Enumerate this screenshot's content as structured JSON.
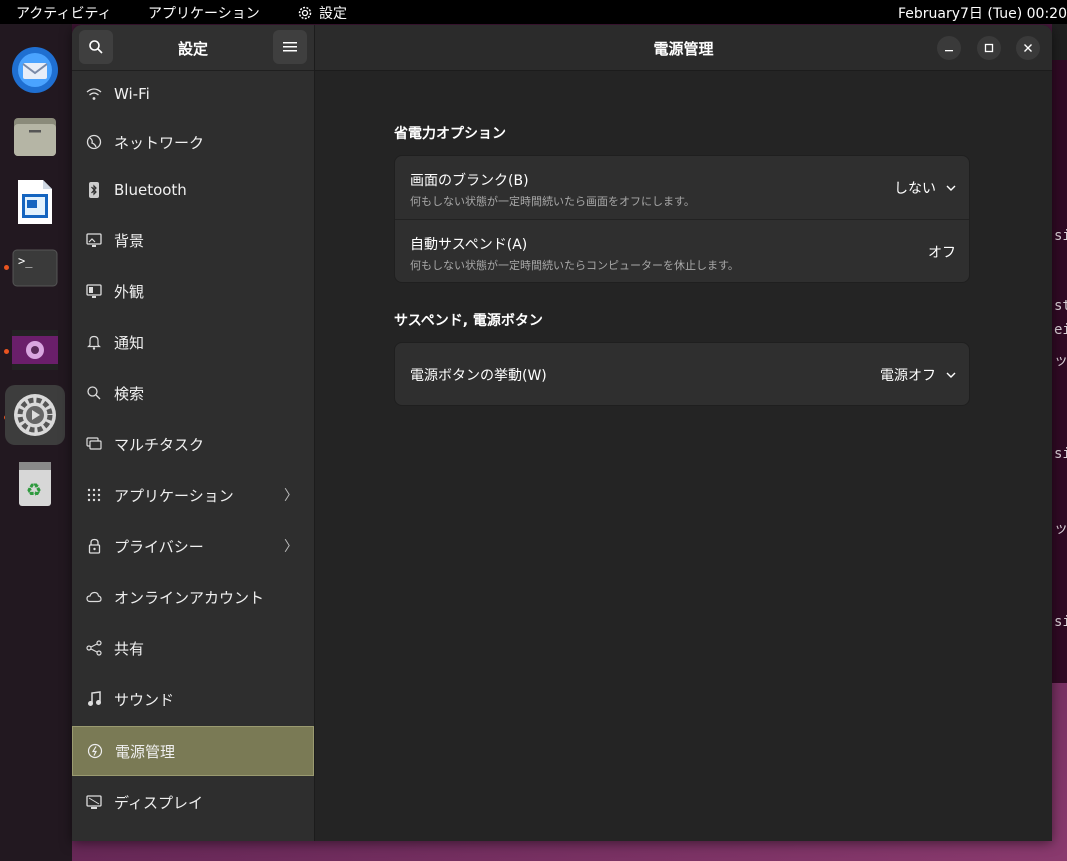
{
  "topbar": {
    "activities": "アクティビティ",
    "applications": "アプリケーション",
    "settings": "設定",
    "clock": "February7日 (Tue)  00:20"
  },
  "dock": {
    "apps": [
      "thunderbird-icon",
      "files-icon",
      "writer-icon",
      "terminal-icon",
      "video-icon",
      "settings-icon",
      "trash-icon"
    ]
  },
  "sidebar": {
    "title": "設定",
    "items": [
      {
        "label": "Wi-Fi",
        "icon": "wifi-icon"
      },
      {
        "label": "ネットワーク",
        "icon": "network-icon"
      },
      {
        "label": "Bluetooth",
        "icon": "bluetooth-icon"
      },
      {
        "label": "背景",
        "icon": "background-icon"
      },
      {
        "label": "外観",
        "icon": "appearance-icon"
      },
      {
        "label": "通知",
        "icon": "bell-icon"
      },
      {
        "label": "検索",
        "icon": "search-icon"
      },
      {
        "label": "マルチタスク",
        "icon": "multitask-icon"
      },
      {
        "label": "アプリケーション",
        "icon": "apps-grid-icon",
        "chevron": true
      },
      {
        "label": "プライバシー",
        "icon": "lock-icon",
        "chevron": true
      },
      {
        "label": "オンラインアカウント",
        "icon": "cloud-icon"
      },
      {
        "label": "共有",
        "icon": "share-icon"
      },
      {
        "label": "サウンド",
        "icon": "music-note-icon"
      },
      {
        "label": "電源管理",
        "icon": "power-icon",
        "selected": true
      },
      {
        "label": "ディスプレイ",
        "icon": "display-icon"
      }
    ]
  },
  "main": {
    "title": "電源管理",
    "section1": {
      "title": "省電力オプション",
      "rows": [
        {
          "title": "画面のブランク(B)",
          "subtitle": "何もしない状態が一定時間続いたら画面をオフにします。",
          "value": "しない"
        },
        {
          "title": "自動サスペンド(A)",
          "subtitle": "何もしない状態が一定時間続いたらコンピューターを休止します。",
          "value": "オフ"
        }
      ]
    },
    "section2": {
      "title": "サスペンド, 電源ボタン",
      "rows": [
        {
          "title": "電源ボタンの挙動(W)",
          "value": "電源オフ"
        }
      ]
    }
  },
  "background_terminal": {
    "lines": [
      "si",
      "st",
      "ei",
      "ッ",
      "si",
      "ッ",
      "si"
    ]
  },
  "colors": {
    "accent": "#e95420",
    "selected_bg": "#7a7a55",
    "window_bg": "#242424",
    "sidebar_bg": "#2e2e2e"
  }
}
